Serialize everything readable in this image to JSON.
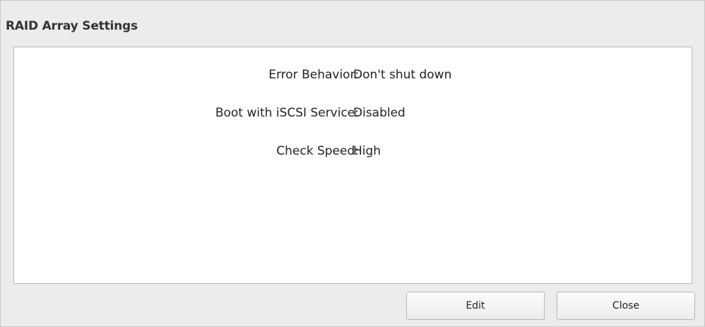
{
  "dialog": {
    "title": "RAID Array Settings",
    "settings": [
      {
        "label": "Error Behavior:",
        "value": "Don't shut down"
      },
      {
        "label": "Boot with iSCSI Service:",
        "value": "Disabled"
      },
      {
        "label": "Check Speed:",
        "value": "High"
      }
    ],
    "buttons": {
      "edit_label": "Edit",
      "close_label": "Close"
    }
  }
}
